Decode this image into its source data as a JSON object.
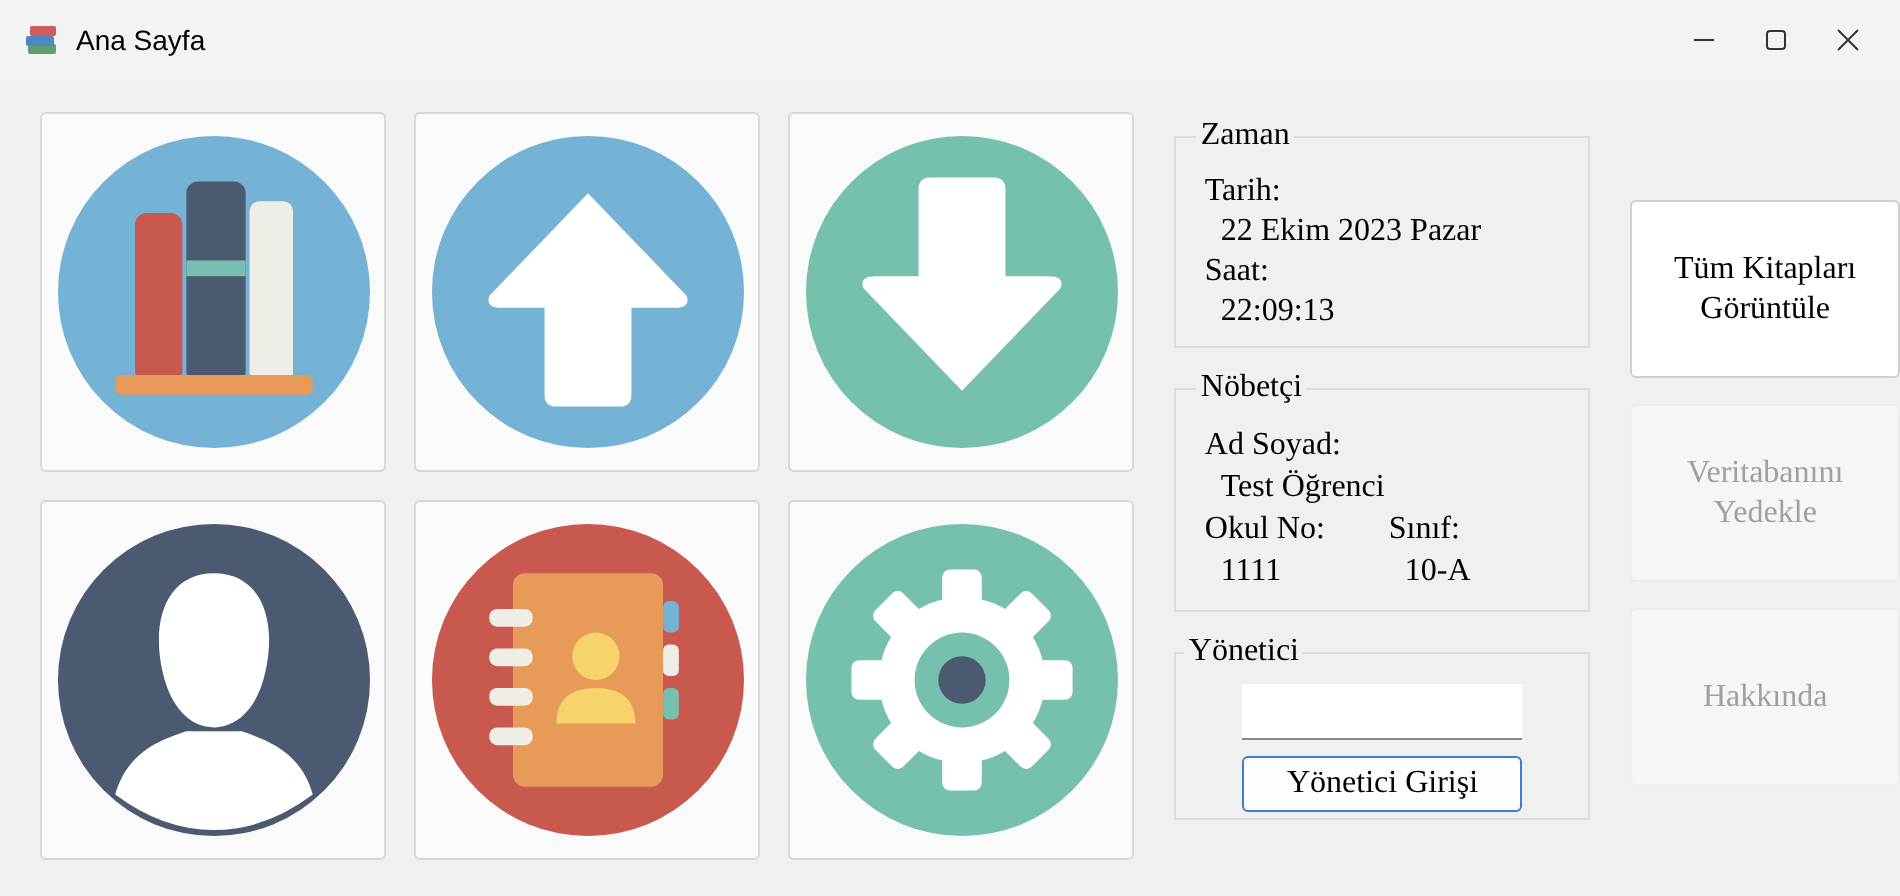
{
  "window": {
    "title": "Ana Sayfa"
  },
  "tiles": [
    {
      "kind": "books"
    },
    {
      "kind": "upload"
    },
    {
      "kind": "download"
    },
    {
      "kind": "person"
    },
    {
      "kind": "contacts"
    },
    {
      "kind": "settings"
    }
  ],
  "zaman": {
    "title": "Zaman",
    "date_label": "Tarih:",
    "date": "22 Ekim 2023 Pazar",
    "time_label": "Saat:",
    "time": "22:09:13"
  },
  "nobetci": {
    "title": "Nöbetçi",
    "name_label": "Ad Soyad:",
    "name": "Test Öğrenci",
    "number_label": "Okul No:",
    "number": "1111",
    "class_label": "Sınıf:",
    "class": "10-A"
  },
  "yonetici": {
    "title": "Yönetici",
    "button": "Yönetici Girişi"
  },
  "buttons": [
    {
      "label": "Tüm Kitapları Görüntüle",
      "disabled": false
    },
    {
      "label": "Veritabanını Yedekle",
      "disabled": true
    },
    {
      "label": "Hakkında",
      "disabled": true
    }
  ]
}
